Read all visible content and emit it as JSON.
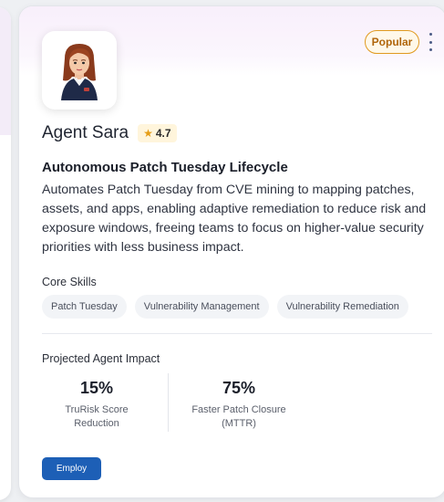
{
  "badge": {
    "label": "Popular"
  },
  "agent": {
    "name": "Agent Sara",
    "rating": "4.7",
    "rating_icon": "star-icon",
    "title": "Autonomous Patch Tuesday Lifecycle",
    "description": "Automates Patch Tuesday from CVE mining to mapping patches, assets, and apps, enabling adaptive remediation to reduce risk and exposure windows, freeing teams to focus on higher-value security priorities with less business impact."
  },
  "skills": {
    "heading": "Core Skills",
    "items": [
      "Patch Tuesday",
      "Vulnerability Management",
      "Vulnerability Remediation"
    ]
  },
  "impact": {
    "heading": "Projected Agent Impact",
    "metrics": [
      {
        "value": "15%",
        "label_line1": "TruRisk Score",
        "label_line2": "Reduction"
      },
      {
        "value": "75%",
        "label_line1": "Faster Patch Closure",
        "label_line2": "(MTTR)"
      }
    ]
  },
  "actions": {
    "employ_label": "Employ"
  },
  "colors": {
    "accent": "#1d5fb6",
    "popular_border": "#e09a1f",
    "popular_text": "#b0650a",
    "rating_bg": "#fff5dc",
    "header_tint": "#f8effb"
  }
}
